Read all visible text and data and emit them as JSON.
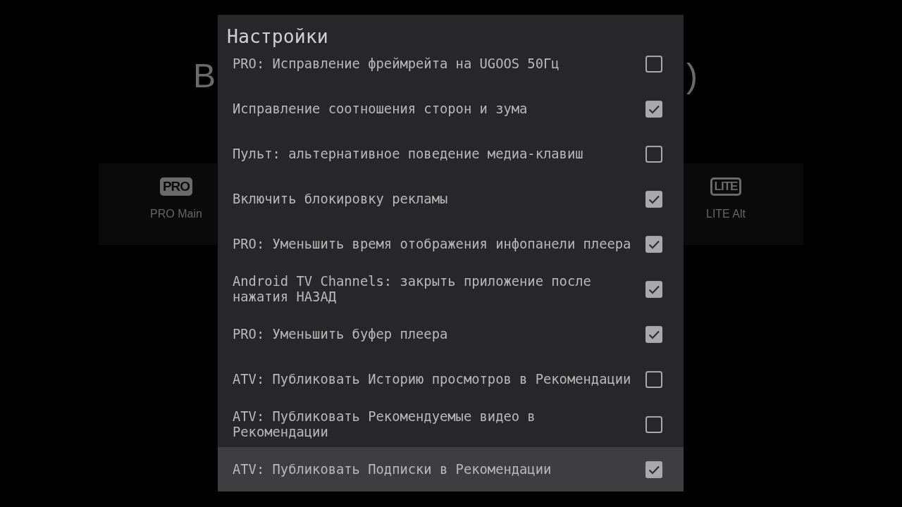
{
  "background": {
    "heading_start": "В",
    "heading_end": ")",
    "cards": [
      {
        "badge": "PRO",
        "kind": "filled",
        "label": "PRO Main"
      },
      {
        "badge": "LITE",
        "kind": "outlined",
        "label": "LITE Alt"
      }
    ]
  },
  "dialog": {
    "title": "Настройки",
    "items": [
      {
        "label": "PRO: Исправление фреймрейта на UGOOS 50Гц",
        "checked": false,
        "selected": false
      },
      {
        "label": "Исправление соотношения сторон и зума",
        "checked": true,
        "selected": false
      },
      {
        "label": "Пульт: альтернативное поведение медиа-клавиш",
        "checked": false,
        "selected": false
      },
      {
        "label": "Включить блокировку рекламы",
        "checked": true,
        "selected": false
      },
      {
        "label": "PRO: Уменьшить время отображения инфопанели плеера",
        "checked": true,
        "selected": false
      },
      {
        "label": "Android TV Channels: закрыть приложение после нажатия НАЗАД",
        "checked": true,
        "selected": false
      },
      {
        "label": "PRO: Уменьшить буфер плеера",
        "checked": true,
        "selected": false
      },
      {
        "label": "ATV: Публиковать Историю просмотров в Рекомендации",
        "checked": false,
        "selected": false
      },
      {
        "label": "ATV: Публиковать Рекомендуемые видео в Рекомендации",
        "checked": false,
        "selected": false
      },
      {
        "label": "ATV: Публиковать Подписки в Рекомендации",
        "checked": true,
        "selected": true
      }
    ]
  }
}
